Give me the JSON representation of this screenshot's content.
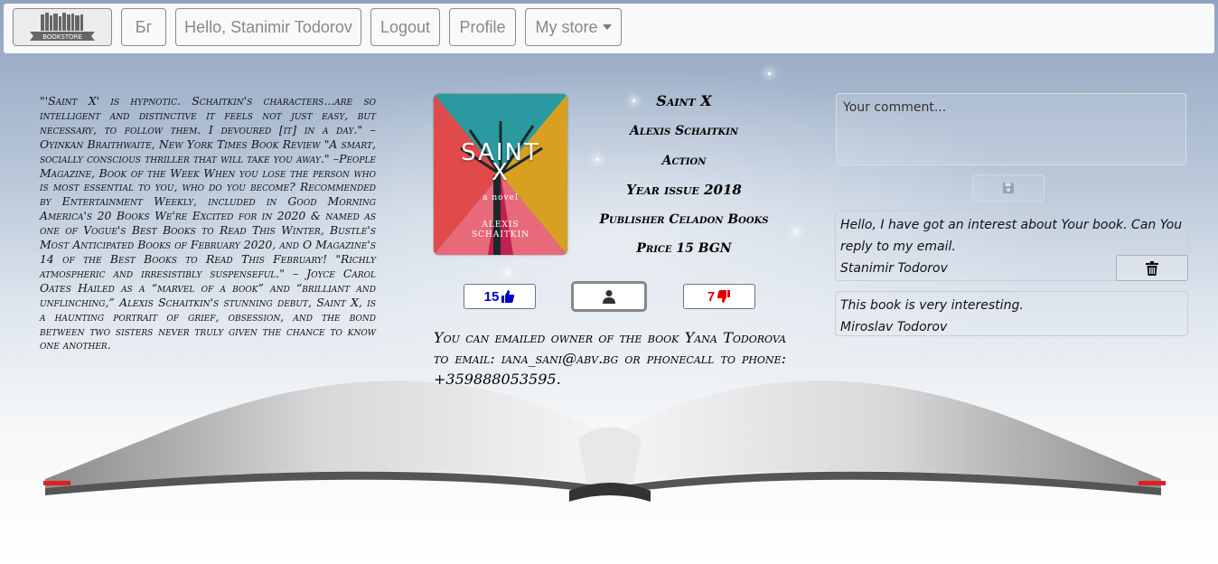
{
  "navbar": {
    "brand_label": "BOOKSTORE",
    "language_label": "Бг",
    "greeting": "Hello, Stanimir Todorov",
    "logout_label": "Logout",
    "profile_label": "Profile",
    "store_label": "My store"
  },
  "book": {
    "description": "\"'Saint X' is hypnotic. Schaitkin's characters...are so intelligent and distinctive it feels not just easy, but necessary, to follow them. I devoured [it] in a day.\" –Oyinkan Braithwaite, New York Times Book Review \"A smart, socially conscious thriller that will take you away.\" –People Magazine, Book of the Week When you lose the person who is most essential to you, who do you become? Recommended by Entertainment Weekly, included in Good Morning America's 20 Books We're Excited for in 2020 & named as one of Vogue's Best Books to Read This Winter, Bustle's Most Anticipated Books of February 2020, and O Magazine's 14 of the Best Books to Read This February! \"Richly atmospheric and irresistibly suspenseful.\" – Joyce Carol Oates Hailed as a “marvel of a book” and “brilliant and unflinching,” Alexis Schaitkin's stunning debut, Saint X, is a haunting portrait of grief, obsession, and the bond between two sisters never truly given the chance to know one another.",
    "cover": {
      "title_line1": "SAINT",
      "title_line2": "X",
      "subtitle": "a novel",
      "author_line1": "ALEXIS",
      "author_line2": "SCHAITKIN"
    },
    "title": "Saint X",
    "author": "Alexis Schaitkin",
    "genre": "Action",
    "year_issue": "Year issue 2018",
    "publisher": "Publisher Celadon Books",
    "price": "Price 15 BGN",
    "likes": "15",
    "dislikes": "7",
    "contact_text": "You can emailed owner of the book Yana Todorova to email: iana_sani@abv.bg or phonecall to phone: +359888053595."
  },
  "comments": {
    "input_placeholder": "Your comment...",
    "items": [
      {
        "text": "Hello, I have got an interest about Your book. Can You reply to my email.",
        "author": "Stanimir Todorov"
      },
      {
        "text": "This book is very interesting.",
        "author": "Miroslav Todorov"
      }
    ]
  },
  "colors": {
    "like": "#0000cc",
    "dislike": "#e00000",
    "navbar_bg": "#f8f9fa"
  },
  "icons": {
    "like": "thumbs-up-icon",
    "dislike": "thumbs-down-icon",
    "owner": "user-icon",
    "save": "floppy-disk-icon",
    "delete": "trash-icon"
  }
}
